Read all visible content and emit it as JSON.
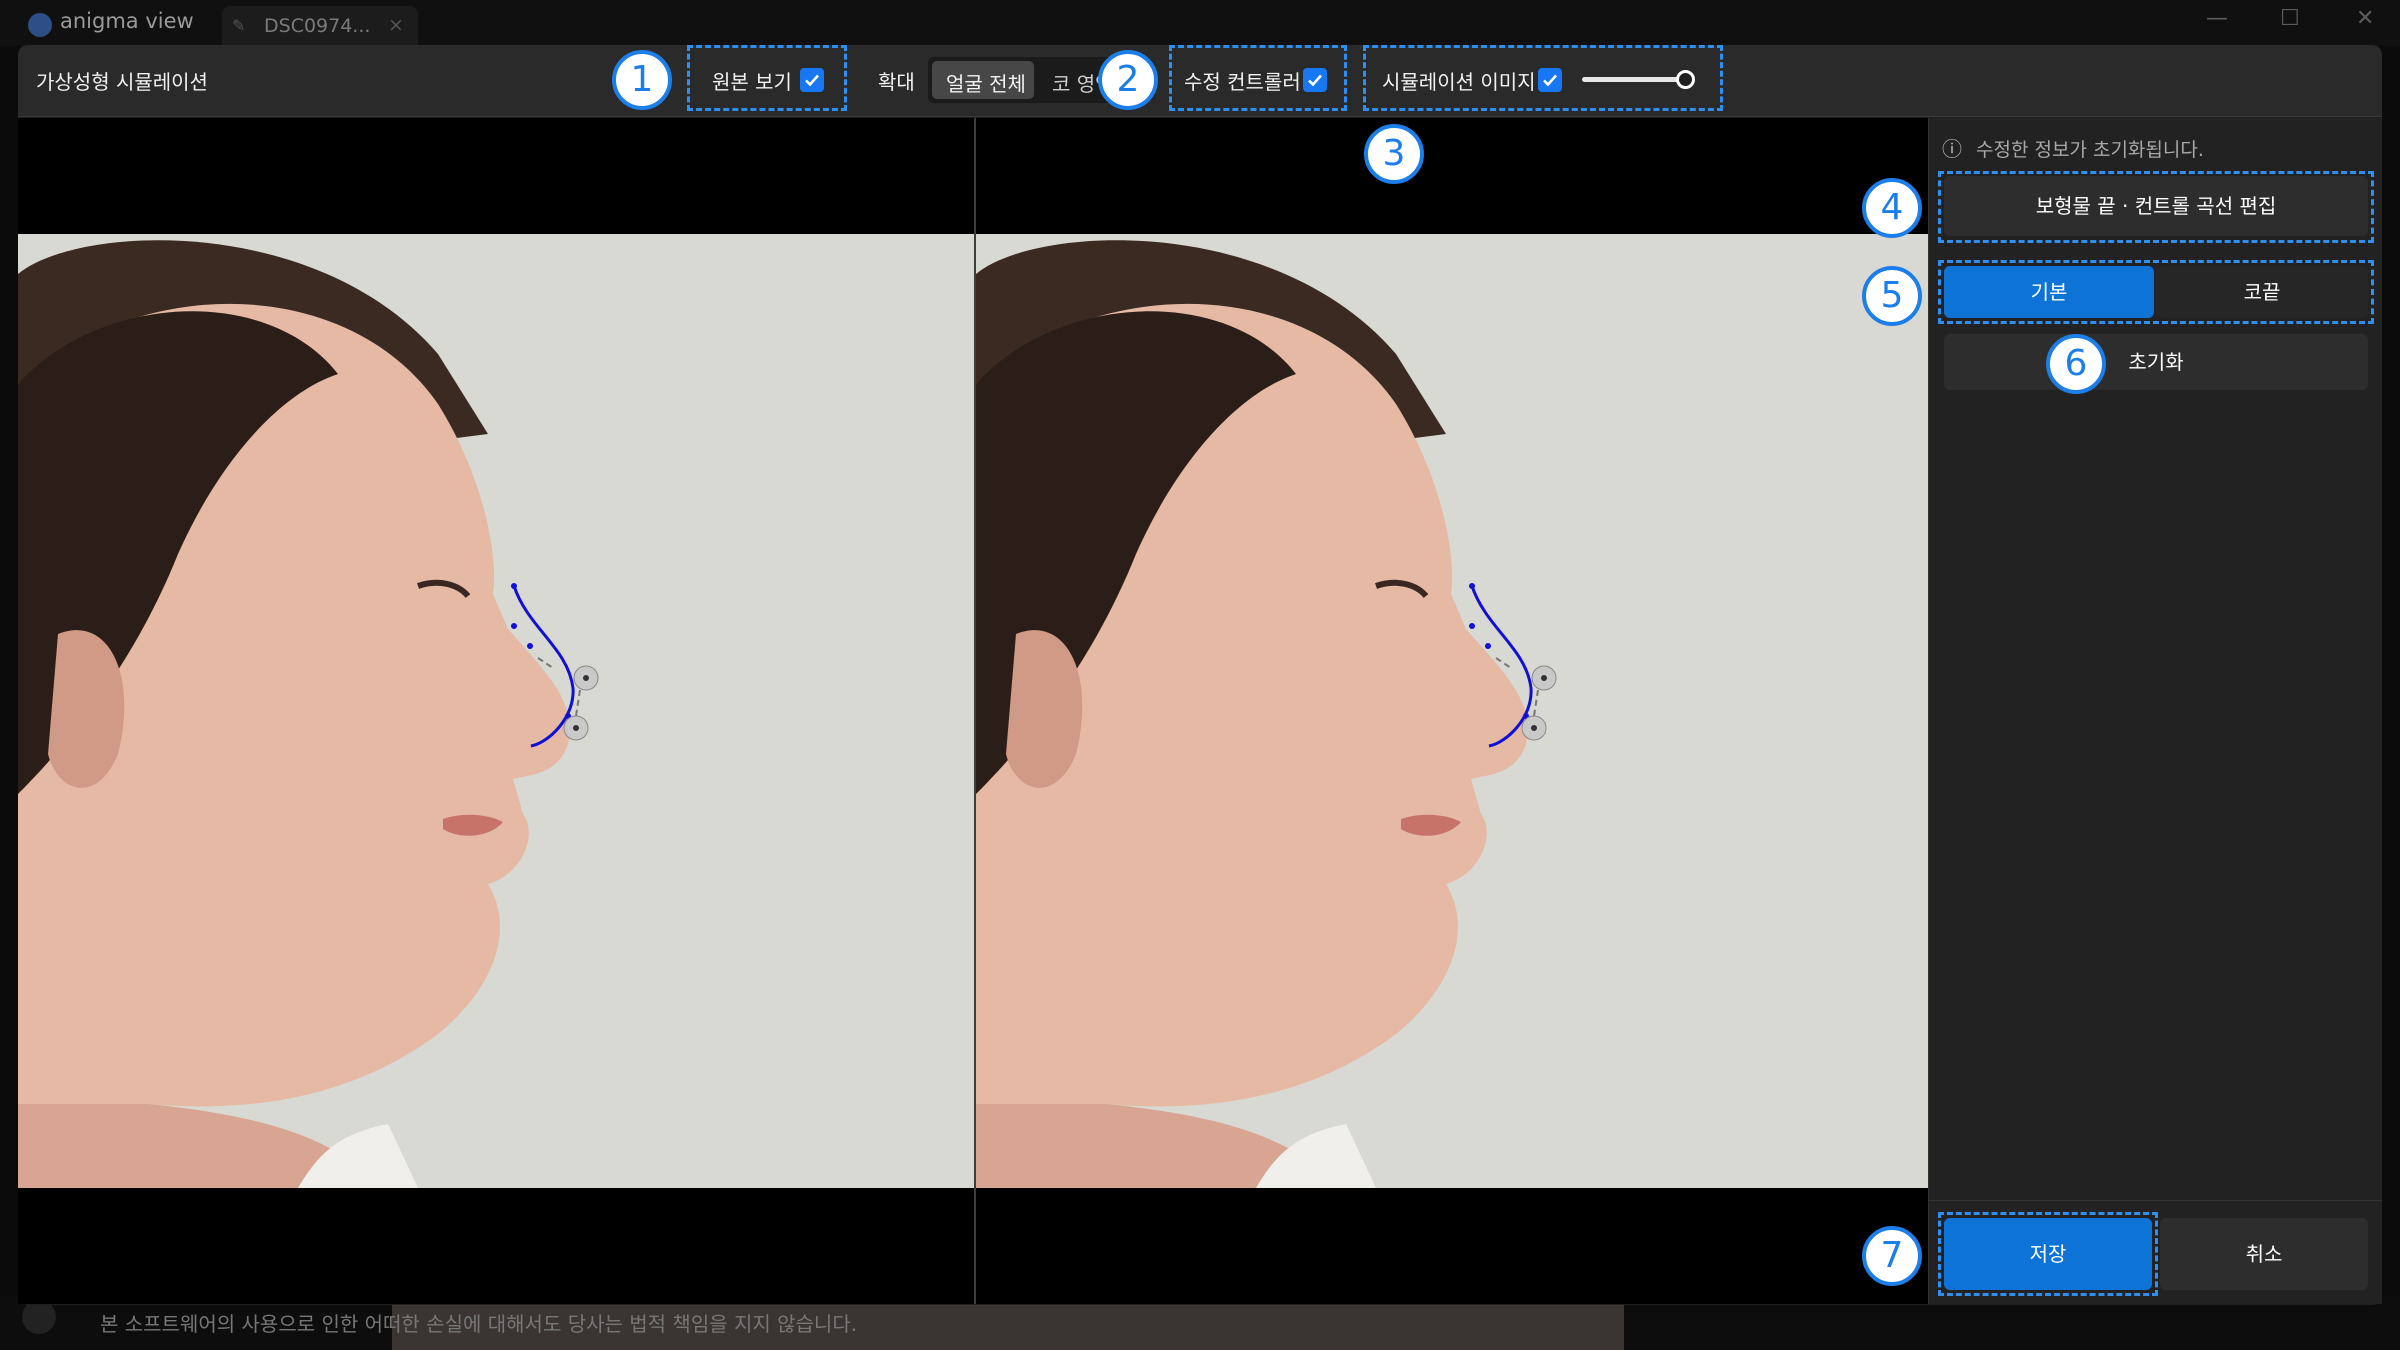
{
  "app": {
    "name": "anigma view",
    "tab_label": "DSC0974...",
    "tab_close": "×",
    "win_minimize": "—",
    "win_maximize": "☐",
    "win_close": "✕"
  },
  "background": {
    "notice": "본 소프트웨어의 사용으로 인한 어떠한 손실에 대해서도 당사는 법적 책임을 지지 않습니다."
  },
  "dialog": {
    "title": "가상성형 시뮬레이션",
    "toolbar": {
      "show_original": "원본 보기",
      "zoom_label": "확대",
      "zoom_options": [
        "얼굴 전체",
        "코 영역"
      ],
      "edit_controller": "수정 컨트롤러",
      "sim_image": "시뮬레이션 이미지",
      "sim_opacity": 1.0
    },
    "panel": {
      "notice": "수정한 정보가 초기화됩니다.",
      "edit_curve": "보형물 끝 · 컨트롤 곡선 편집",
      "mode_tabs": [
        "기본",
        "코끝"
      ],
      "reset": "초기화",
      "save": "저장",
      "cancel": "취소"
    }
  },
  "badges": [
    "1",
    "2",
    "3",
    "4",
    "5",
    "6",
    "7"
  ],
  "icons": {
    "info": "ⓘ",
    "check": "✓"
  },
  "colors": {
    "accent": "#1877f2",
    "highlight": "#2f8ff0",
    "button_blue": "#0d73d6",
    "photo_bg": "#d9d9d3",
    "curve": "#1010d8"
  }
}
